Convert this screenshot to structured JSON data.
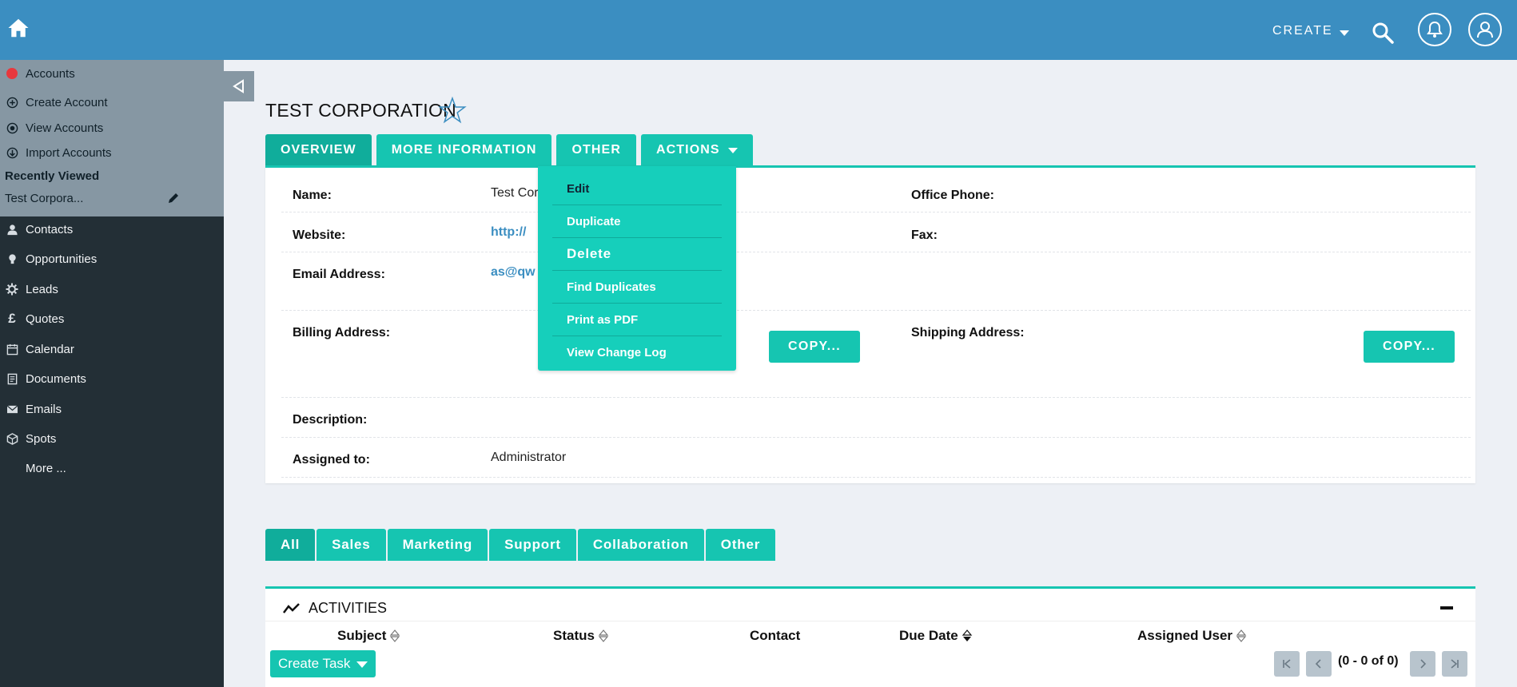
{
  "topbar": {
    "create_label": "CREATE",
    "icons": [
      "home-icon",
      "search-icon",
      "notification-bell-icon",
      "user-profile-icon"
    ]
  },
  "sidebar": {
    "module": "Accounts",
    "actions": [
      {
        "label": "Create Account",
        "icon": "plus-circle-icon"
      },
      {
        "label": "View Accounts",
        "icon": "eye-icon"
      },
      {
        "label": "Import Accounts",
        "icon": "download-icon"
      }
    ],
    "recently_viewed_heading": "Recently Viewed",
    "recent_item": "Test Corpora...",
    "modules": [
      {
        "label": "Contacts",
        "icon": "person-icon"
      },
      {
        "label": "Opportunities",
        "icon": "lightbulb-icon"
      },
      {
        "label": "Leads",
        "icon": "gear-icon"
      },
      {
        "label": "Quotes",
        "icon": "pound-icon"
      },
      {
        "label": "Calendar",
        "icon": "calendar-icon"
      },
      {
        "label": "Documents",
        "icon": "document-icon"
      },
      {
        "label": "Emails",
        "icon": "envelope-icon"
      },
      {
        "label": "Spots",
        "icon": "cube-icon"
      },
      {
        "label": "More ...",
        "icon": ""
      }
    ]
  },
  "record": {
    "title": "TEST CORPORATION",
    "tabs": [
      "OVERVIEW",
      "MORE INFORMATION",
      "OTHER",
      "ACTIONS"
    ],
    "fields": {
      "name_label": "Name:",
      "name_value": "Test Cor",
      "website_label": "Website:",
      "website_value": "http://",
      "email_label": "Email Address:",
      "email_value": "as@qw",
      "billing_label": "Billing Address:",
      "description_label": "Description:",
      "assigned_label": "Assigned to:",
      "assigned_value": "Administrator",
      "office_phone_label": "Office Phone:",
      "fax_label": "Fax:",
      "shipping_label": "Shipping Address:"
    },
    "copy_label": "COPY..."
  },
  "actions_menu": [
    "Edit",
    "Duplicate",
    "Delete",
    "Find Duplicates",
    "Print as PDF",
    "View Change Log"
  ],
  "subpanel_tabs": [
    "All",
    "Sales",
    "Marketing",
    "Support",
    "Collaboration",
    "Other"
  ],
  "activities": {
    "title": "ACTIVITIES",
    "columns": [
      "Subject",
      "Status",
      "Contact",
      "Due Date",
      "Assigned User"
    ],
    "create_task_label": "Create Task",
    "pagination": "(0 - 0 of 0)"
  },
  "colors": {
    "topbar": "#3b8ec1",
    "accent": "#16c5b1",
    "sidebar_dark": "#232f36",
    "sidebar_light": "#8697a3"
  }
}
